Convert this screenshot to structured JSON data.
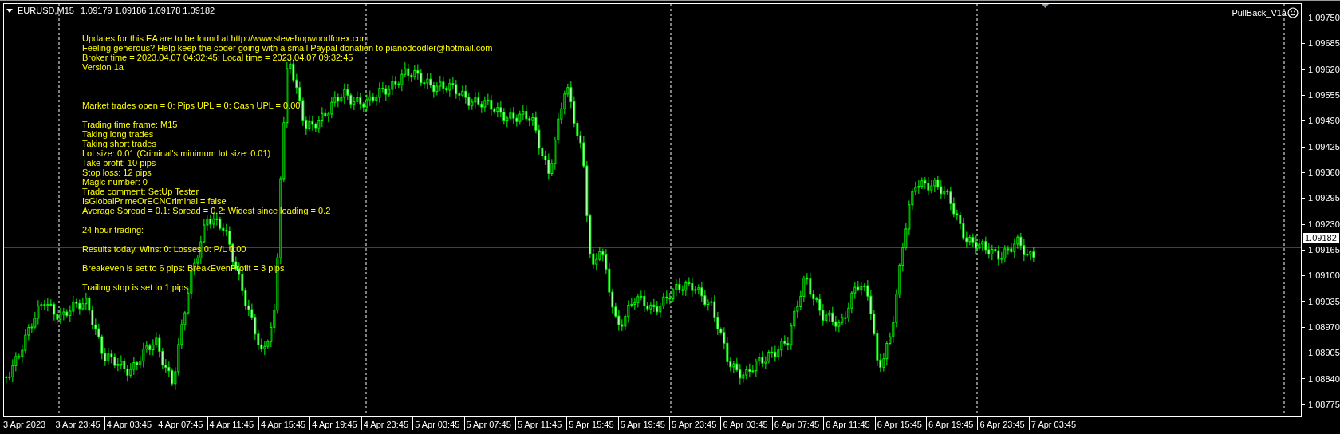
{
  "chart": {
    "symbol": "EURUSD,M15",
    "quotes": "1.09179 1.09186 1.09178 1.09182",
    "expert": "PullBack_V1a",
    "info_groups": [
      [
        "Updates for this EA are to be found at http://www.stevehopwoodforex.com",
        "Feeling generous? Help keep the coder going with a small Paypal donation to pianodoodler@hotmail.com",
        "Broker time = 2023.04.07 04:32:45: Local time = 2023.04.07 09:32:45",
        "Version 1a"
      ],
      [
        "Market trades open = 0: Pips UPL = 0: Cash UPL = 0.00"
      ],
      [
        "Trading time frame: M15",
        "Taking long trades",
        "Taking short trades",
        "Lot size: 0.01 (Criminal's minimum lot size: 0.01)",
        "Take profit: 10 pips",
        "Stop loss: 12 pips",
        "Magic number: 0",
        "Trade comment: SetUp Tester",
        "IsGlobalPrimeOrECNCriminal = false",
        "Average Spread = 0.1: Spread = 0.2: Widest since loading = 0.2"
      ],
      [
        "24 hour trading:"
      ],
      [
        "Results today. Wins: 0: Losses 0: P/L 0.00"
      ],
      [
        "Breakeven is set to 6 pips: BreakEvenProfit = 3 pips"
      ],
      [
        "Trailing stop is set to 1 pips"
      ]
    ],
    "current_price": "1.09182",
    "price_axis": [
      "1.09750",
      "1.09685",
      "1.09620",
      "1.09555",
      "1.09490",
      "1.09425",
      "1.09360",
      "1.09295",
      "1.09230",
      "1.09165",
      "1.09100",
      "1.09035",
      "1.08970",
      "1.08905",
      "1.08840",
      "1.08775"
    ],
    "time_axis": [
      "3 Apr 2023",
      "3 Apr 23:45",
      "4 Apr 03:45",
      "4 Apr 07:45",
      "4 Apr 11:45",
      "4 Apr 15:45",
      "4 Apr 19:45",
      "4 Apr 23:45",
      "5 Apr 03:45",
      "5 Apr 07:45",
      "5 Apr 11:45",
      "5 Apr 15:45",
      "5 Apr 19:45",
      "5 Apr 23:45",
      "6 Apr 03:45",
      "6 Apr 07:45",
      "6 Apr 11:45",
      "6 Apr 15:45",
      "6 Apr 19:45",
      "6 Apr 23:45",
      "7 Apr 03:45"
    ]
  }
}
